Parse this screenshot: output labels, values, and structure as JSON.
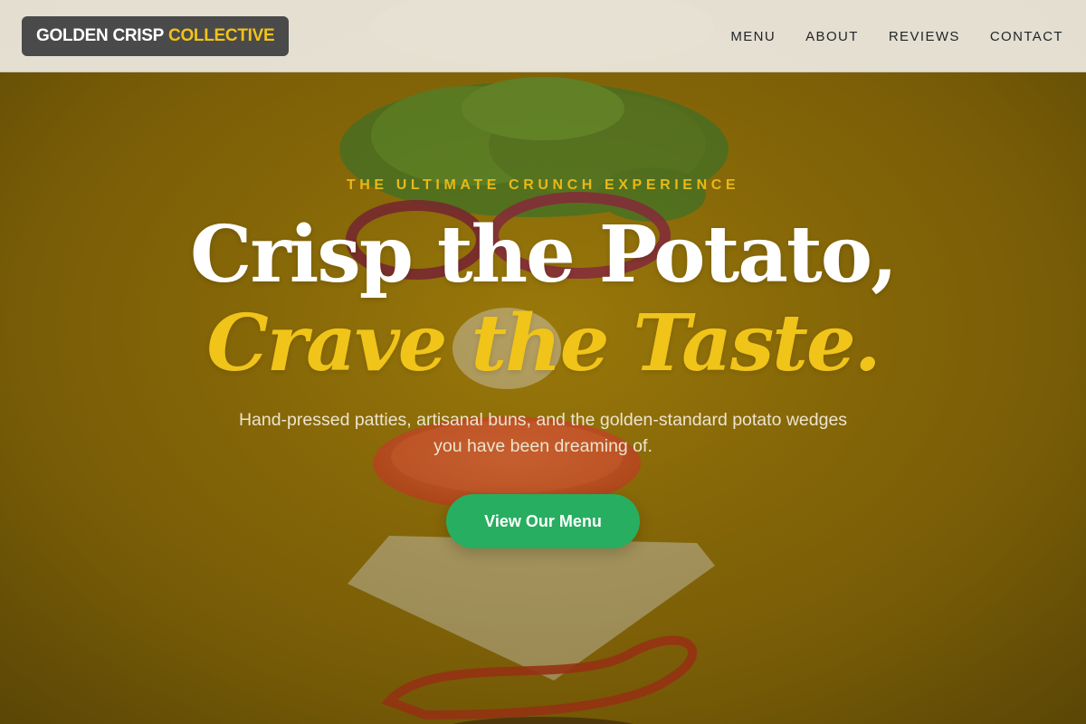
{
  "header": {
    "logo_main": "GOLDEN CRISP",
    "logo_accent": "COLLECTIVE",
    "nav": [
      {
        "label": "MENU"
      },
      {
        "label": "ABOUT"
      },
      {
        "label": "REVIEWS"
      },
      {
        "label": "CONTACT"
      }
    ]
  },
  "hero": {
    "eyebrow": "THE ULTIMATE CRUNCH EXPERIENCE",
    "headline_line1": "Crisp the Potato,",
    "headline_line2": "Crave the Taste.",
    "subtext": "Hand-pressed patties, artisanal buns, and the golden-standard potato wedges you have been dreaming of.",
    "cta_label": "View Our Menu",
    "background_image": "floating-burger-ingredients-photo"
  },
  "colors": {
    "accent": "#f0c419",
    "cta": "#27ae60",
    "header_bg": "#ece8de",
    "logo_bg": "#4a4a4a"
  }
}
